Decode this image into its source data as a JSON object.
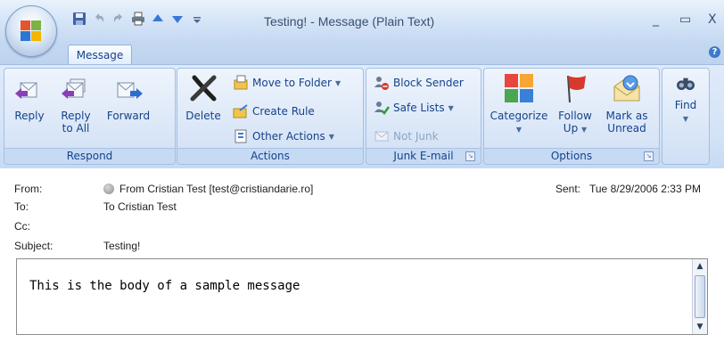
{
  "window": {
    "title": "Testing! - Message (Plain Text)",
    "controls": {
      "minimize": "_",
      "maximize": "▭",
      "close": "X"
    }
  },
  "qat_icons": [
    "save-icon",
    "undo-icon",
    "redo-icon",
    "print-icon",
    "previous-icon",
    "next-icon",
    "customize-qat-icon"
  ],
  "tabs": [
    {
      "label": "Message",
      "active": true
    }
  ],
  "ribbon": {
    "respond": {
      "label": "Respond",
      "reply": "Reply",
      "reply_all_1": "Reply",
      "reply_all_2": "to All",
      "forward": "Forward"
    },
    "actions": {
      "label": "Actions",
      "delete": "Delete",
      "move_to_folder": "Move to Folder",
      "create_rule": "Create Rule",
      "other_actions": "Other Actions"
    },
    "junk": {
      "label": "Junk E-mail",
      "block_sender": "Block Sender",
      "safe_lists": "Safe Lists",
      "not_junk": "Not Junk"
    },
    "options": {
      "label": "Options",
      "categorize": "Categorize",
      "follow_up_1": "Follow",
      "follow_up_2": "Up",
      "mark_unread_1": "Mark as",
      "mark_unread_2": "Unread"
    },
    "find": {
      "label": "Find"
    }
  },
  "message": {
    "from_label": "From:",
    "from_value": "From Cristian Test [test@cristiandarie.ro]",
    "sent_label": "Sent:",
    "sent_value": "Tue 8/29/2006 2:33 PM",
    "to_label": "To:",
    "to_value": "To Cristian Test",
    "cc_label": "Cc:",
    "cc_value": "",
    "subject_label": "Subject:",
    "subject_value": "Testing!",
    "body": "This is the body of a sample message"
  },
  "colors": {
    "ribbon_text": "#15428b",
    "accent": "#3c7ac9"
  }
}
